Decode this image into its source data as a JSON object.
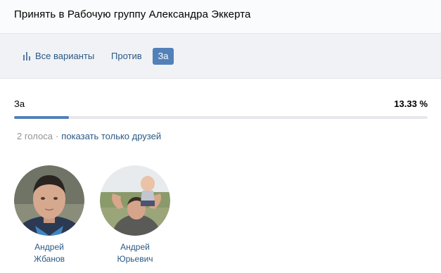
{
  "header": {
    "title": "Принять в Рабочую группу Александра Эккерта"
  },
  "tabs": [
    {
      "label": "Все варианты",
      "icon": "bar-chart-icon",
      "active": false
    },
    {
      "label": "Против",
      "active": false
    },
    {
      "label": "За",
      "active": true
    }
  ],
  "result": {
    "option": "За",
    "percent": "13.33 %",
    "fraction": 0.1333
  },
  "meta": {
    "votes": "2 голоса",
    "separator": "·",
    "friends_link": "показать только друзей"
  },
  "voters": [
    {
      "first_name": "Андрей",
      "last_name": "Жбанов"
    },
    {
      "first_name": "Андрей",
      "last_name": "Юрьевич"
    }
  ],
  "colors": {
    "accent": "#5181b8",
    "link": "#2a5885",
    "track": "#e7e8ec",
    "muted": "#939393"
  }
}
